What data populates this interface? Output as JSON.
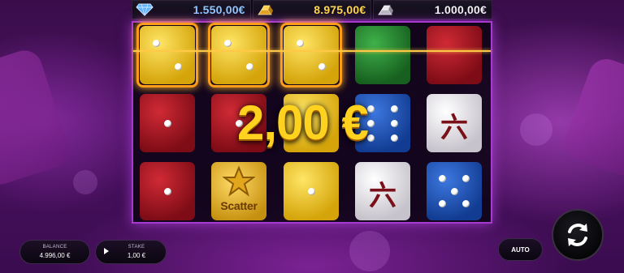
{
  "jackpots": [
    {
      "icon": "diamond-icon",
      "value": "1.550,00€"
    },
    {
      "icon": "gold-bars-icon",
      "value": "8.975,00€"
    },
    {
      "icon": "silver-bars-icon",
      "value": "1.000,00€"
    }
  ],
  "win_amount": "2,00 €",
  "grid": {
    "rows": [
      [
        {
          "color": "yellow",
          "face": "2",
          "winning": true
        },
        {
          "color": "yellow",
          "face": "2",
          "winning": true
        },
        {
          "color": "yellow",
          "face": "2",
          "winning": true
        },
        {
          "color": "green",
          "face": "blank"
        },
        {
          "color": "red",
          "face": "blank"
        }
      ],
      [
        {
          "color": "red",
          "face": "1"
        },
        {
          "color": "red",
          "face": "1"
        },
        {
          "color": "yellow",
          "face": "blank"
        },
        {
          "color": "blue",
          "face": "6"
        },
        {
          "color": "white",
          "face": "六"
        }
      ],
      [
        {
          "color": "red",
          "face": "1"
        },
        {
          "color": "scatter",
          "face": "Scatter"
        },
        {
          "color": "yellow",
          "face": "1"
        },
        {
          "color": "white",
          "face": "六"
        },
        {
          "color": "blue",
          "face": "5"
        }
      ]
    ]
  },
  "balance": {
    "label": "BALANCE",
    "value": "4.996,00 €"
  },
  "stake": {
    "label": "STAKE",
    "value": "1,00 €"
  },
  "auto_label": "AUTO",
  "colors": {
    "frame": "#a63ad0",
    "win_text": "#ffd21f",
    "win_highlight": "#ff9d1a"
  }
}
